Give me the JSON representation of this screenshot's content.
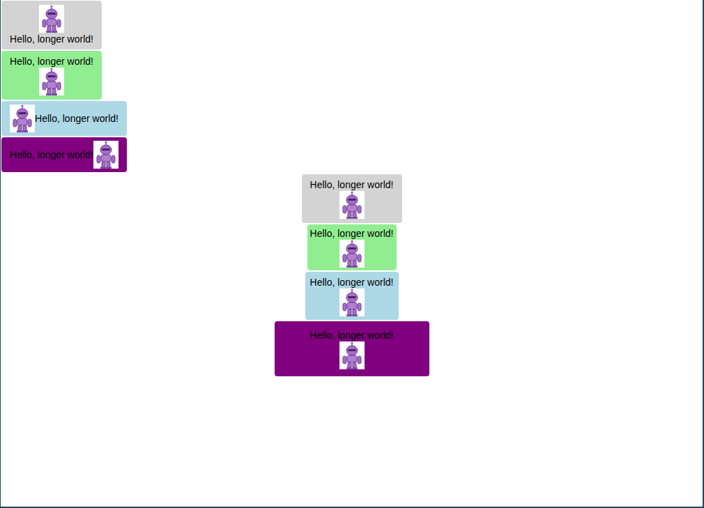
{
  "left_column": [
    {
      "text": "Hello, longer world!",
      "kind": "image-top",
      "color": "#d3d3d3"
    },
    {
      "text": "Hello, longer world!",
      "kind": "image-bottom",
      "color": "#90ee90"
    },
    {
      "text": "Hello, longer world!",
      "kind": "image-left",
      "color": "#add8e6"
    },
    {
      "text": "Hello, longer world!",
      "kind": "image-right",
      "color": "#800080"
    }
  ],
  "center_column": [
    {
      "text": "Hello, longer world!",
      "kind": "image-bottom",
      "color": "#d3d3d3"
    },
    {
      "text": "Hello, longer world!",
      "kind": "image-bottom",
      "color": "#90ee90"
    },
    {
      "text": "Hello, longer world!",
      "kind": "image-bottom",
      "color": "#add8e6"
    },
    {
      "text": "Hello, longer world!",
      "kind": "image-bottom",
      "color": "#800080"
    }
  ]
}
